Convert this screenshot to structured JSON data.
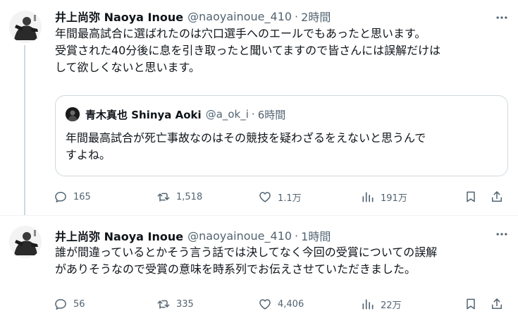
{
  "tweets": [
    {
      "author_name": "井上尚弥 Naoya Inoue",
      "handle": "@naoyainoue_410",
      "separator": "·",
      "time": "2時間",
      "text_lines": [
        "年間最高試合に選ばれたのは穴口選手へのエールでもあったと思います。",
        "受賞された40分後に息を引き取ったと聞いてますので皆さんには誤解だけは",
        "して欲しくないと思います。"
      ],
      "quote": {
        "author_name": "青木真也 Shinya Aoki",
        "handle": "@a_ok_i",
        "separator": "·",
        "time": "6時間",
        "text_lines": [
          "年間最高試合が死亡事故なのはその競技を疑わざるをえないと思うんで",
          "すよね。"
        ]
      },
      "stats": {
        "replies": "165",
        "retweets": "1,518",
        "likes": "1.1万",
        "views": "191万"
      }
    },
    {
      "author_name": "井上尚弥 Naoya Inoue",
      "handle": "@naoyainoue_410",
      "separator": "·",
      "time": "1時間",
      "text_lines": [
        "誰が間違っているとかそう言う話では決してなく今回の受賞についての誤解",
        "がありそうなので受賞の意味を時系列でお伝えさせていただきました。"
      ],
      "stats": {
        "replies": "56",
        "retweets": "335",
        "likes": "4,406",
        "views": "22万"
      }
    }
  ],
  "icons": {
    "reply": "reply-icon",
    "retweet": "retweet-icon",
    "like": "heart-icon",
    "views": "views-icon",
    "bookmark": "bookmark-icon",
    "share": "share-icon",
    "more": "more-icon"
  },
  "colors": {
    "text": "#0f1419",
    "secondary": "#536471",
    "border": "#cfd9de",
    "thread_line": "#cfd9de"
  }
}
